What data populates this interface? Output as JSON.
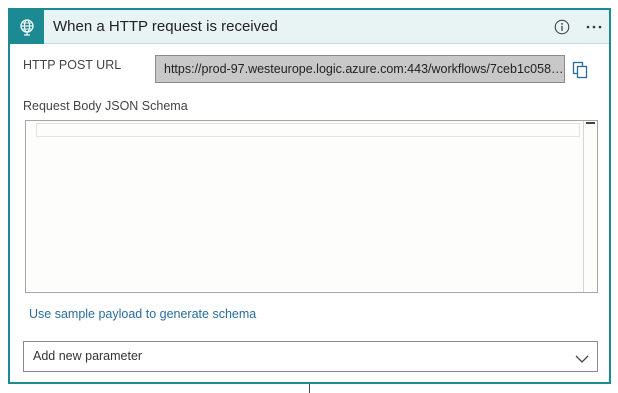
{
  "card": {
    "title": "When a HTTP request is received",
    "accent_color": "#1b8a93",
    "icons": [
      "globe-icon",
      "info-icon",
      "more-options-icon"
    ]
  },
  "fields": {
    "url_label": "HTTP POST URL",
    "url_value": "https://prod-97.westeurope.logic.azure.com:443/workflows/7ceb1c058fa...",
    "schema_label": "Request Body JSON Schema",
    "schema_value": ""
  },
  "links": {
    "sample_payload": "Use sample payload to generate schema"
  },
  "add_parameter": {
    "placeholder": "Add new parameter"
  }
}
